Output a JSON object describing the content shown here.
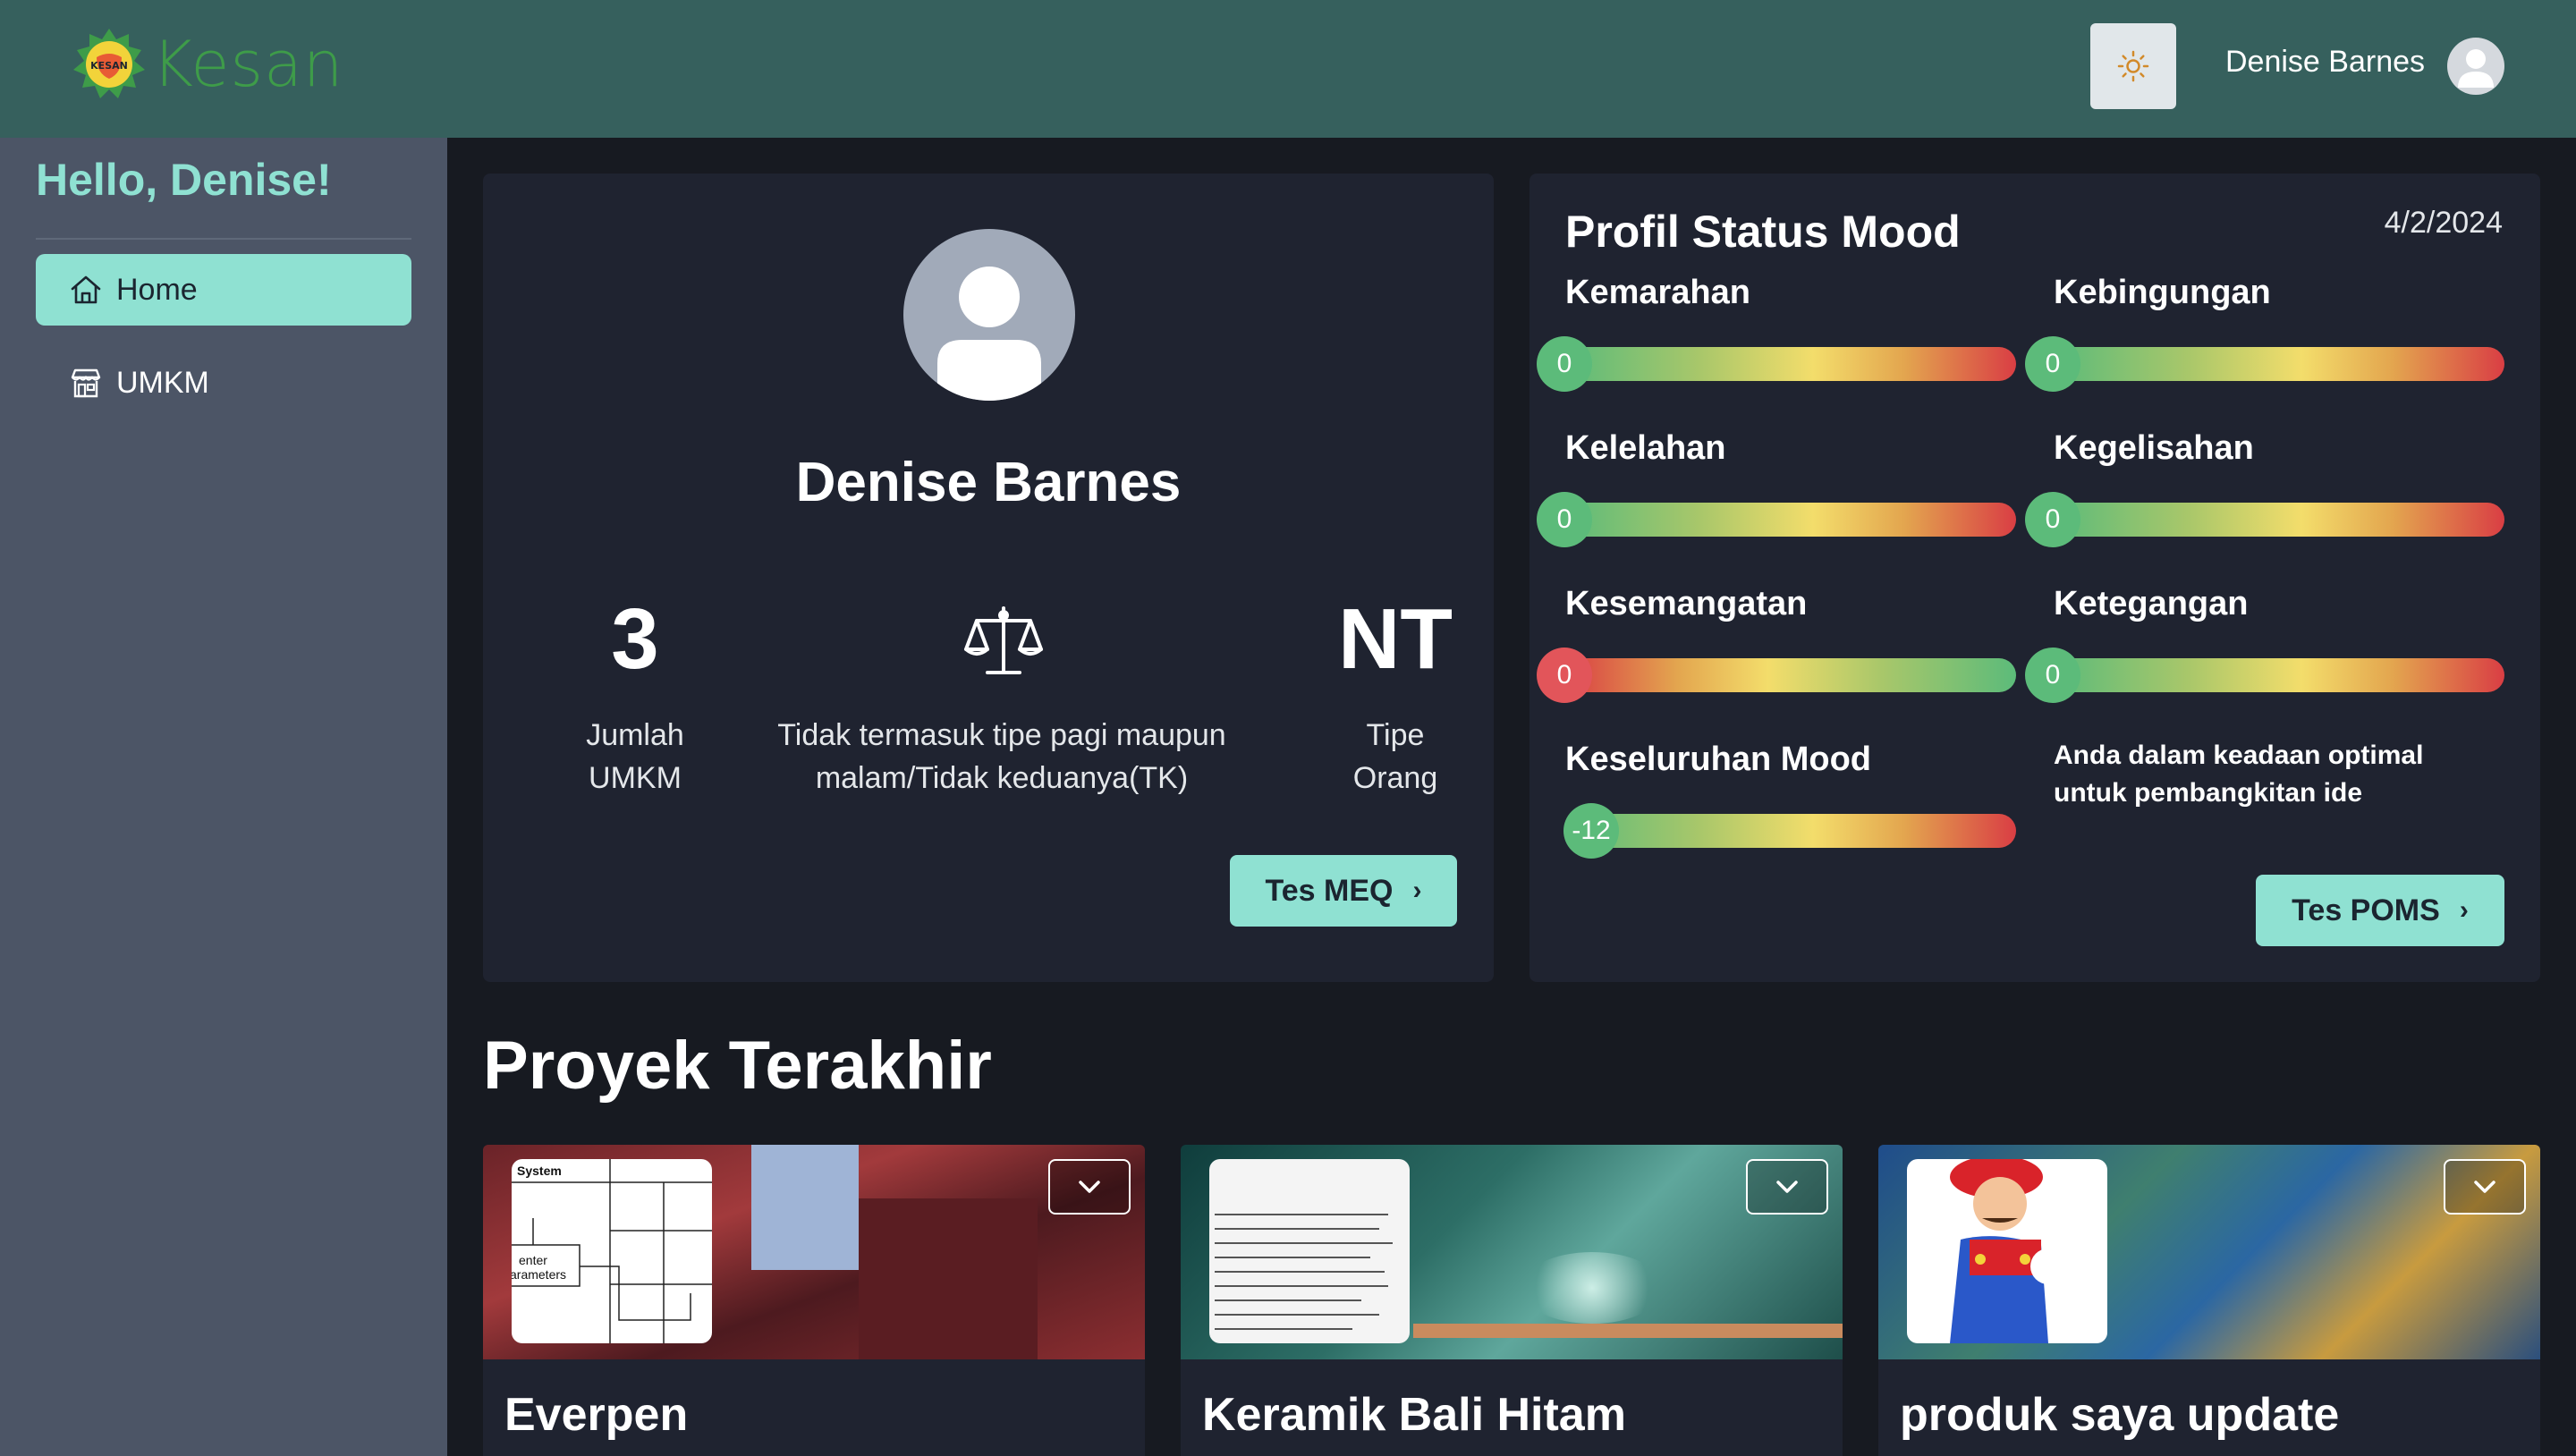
{
  "header": {
    "logo_text": "Kesan",
    "logo_badge": "KESAN",
    "user_name": "Denise Barnes"
  },
  "sidebar": {
    "greeting": "Hello, Denise!",
    "items": [
      {
        "label": "Home",
        "icon": "home-icon",
        "active": true
      },
      {
        "label": "UMKM",
        "icon": "store-icon",
        "active": false
      }
    ]
  },
  "profile": {
    "name": "Denise Barnes",
    "stats": [
      {
        "value": "3",
        "label_line1": "Jumlah",
        "label_line2": "UMKM"
      },
      {
        "icon": "scale-icon",
        "label_line1": "Tidak termasuk tipe pagi maupun",
        "label_line2": "malam/Tidak keduanya(TK)"
      },
      {
        "value": "NT",
        "label_line1": "Tipe",
        "label_line2": "Orang"
      }
    ],
    "button_label": "Tes MEQ"
  },
  "mood": {
    "title": "Profil Status Mood",
    "date": "4/2/2024",
    "scales": [
      {
        "label": "Kemarahan",
        "value": "0",
        "direction": "green-to-red"
      },
      {
        "label": "Kebingungan",
        "value": "0",
        "direction": "green-to-red"
      },
      {
        "label": "Kelelahan",
        "value": "0",
        "direction": "green-to-red"
      },
      {
        "label": "Kegelisahan",
        "value": "0",
        "direction": "green-to-red"
      },
      {
        "label": "Kesemangatan",
        "value": "0",
        "direction": "red-to-green"
      },
      {
        "label": "Ketegangan",
        "value": "0",
        "direction": "green-to-red"
      },
      {
        "label": "Keseluruhan Mood",
        "value": "-12",
        "direction": "green-to-red"
      }
    ],
    "message": "Anda dalam keadaan optimal untuk pembangkitan ide",
    "button_label": "Tes POMS"
  },
  "projects": {
    "title": "Proyek Terakhir",
    "items": [
      {
        "name": "Everpen",
        "thumb_text_1": "System",
        "thumb_text_2": "enter",
        "thumb_text_3": "arameters"
      },
      {
        "name": "Keramik Bali Hitam"
      },
      {
        "name": "produk saya update"
      }
    ]
  },
  "colors": {
    "header_bg": "#36605d",
    "sidebar_bg": "#4c5566",
    "page_bg": "#171a21",
    "card_bg": "#1f2330",
    "accent": "#8fe1d2",
    "logo_green": "#3e9c49"
  }
}
